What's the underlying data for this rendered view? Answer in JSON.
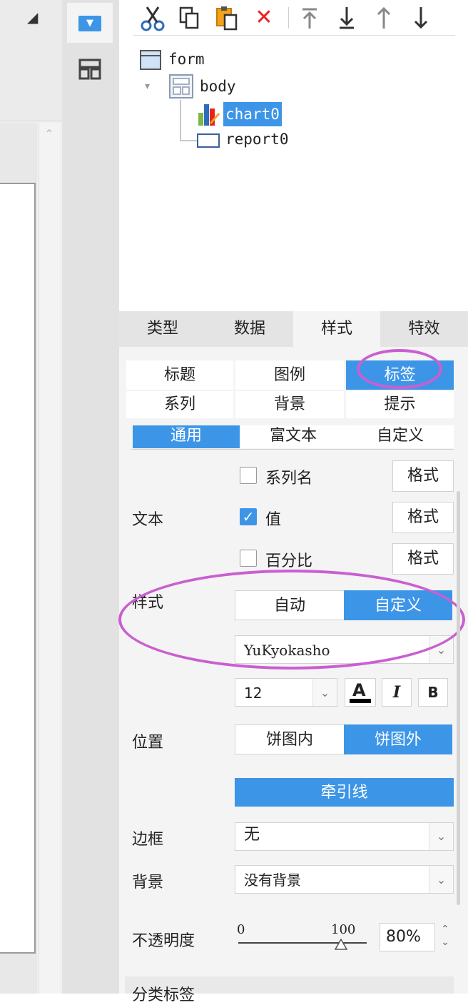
{
  "toolbar": {
    "icons": [
      "cut-icon",
      "copy-icon",
      "paste-icon",
      "delete-icon",
      "move-top-icon",
      "move-bottom-icon",
      "move-up-icon",
      "move-down-icon"
    ]
  },
  "tree": {
    "form": "form",
    "body": "body",
    "chart": "chart0",
    "report": "report0"
  },
  "main_tabs": [
    "类型",
    "数据",
    "样式",
    "特效"
  ],
  "sub_tabs_row1": [
    "标题",
    "图例",
    "标签"
  ],
  "sub_tabs_row2": [
    "系列",
    "背景",
    "提示"
  ],
  "mode_tabs": [
    "通用",
    "富文本",
    "自定义"
  ],
  "text_section": {
    "label": "文本",
    "options": [
      {
        "label": "系列名",
        "checked": false,
        "format_btn": "格式"
      },
      {
        "label": "值",
        "checked": true,
        "format_btn": "格式"
      },
      {
        "label": "百分比",
        "checked": false,
        "format_btn": "格式"
      }
    ]
  },
  "style_section": {
    "label": "样式",
    "auto": "自动",
    "custom": "自定义",
    "font_family": "YuKyokasho",
    "font_size": "12"
  },
  "position_section": {
    "label": "位置",
    "inside": "饼图内",
    "outside": "饼图外",
    "leader_line": "牵引线"
  },
  "border_section": {
    "label": "边框",
    "value": "无"
  },
  "background_section": {
    "label": "背景",
    "value": "没有背景"
  },
  "opacity_section": {
    "label": "不透明度",
    "min": "0",
    "max": "100",
    "value": "80%",
    "level": 0.8
  },
  "next_section": {
    "label": "分类标签"
  },
  "colors": {
    "accent": "#3d95e8",
    "highlight_ring": "#c95fd0",
    "delete_red": "#e8231f"
  }
}
